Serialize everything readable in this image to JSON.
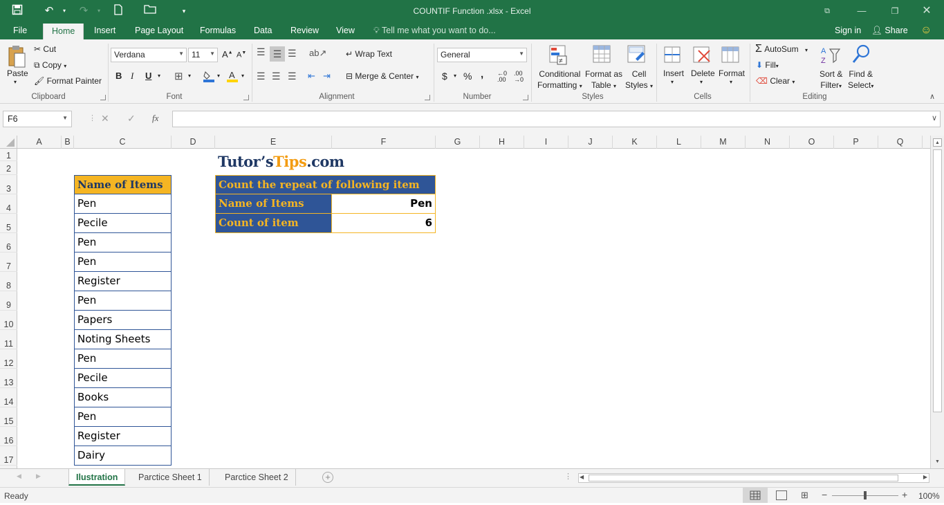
{
  "window": {
    "title": "COUNTIF Function .xlsx - Excel",
    "controls": [
      "restore-ribbon",
      "minimize",
      "maximize",
      "close"
    ]
  },
  "tabs": [
    {
      "label": "File"
    },
    {
      "label": "Home"
    },
    {
      "label": "Insert"
    },
    {
      "label": "Page Layout"
    },
    {
      "label": "Formulas"
    },
    {
      "label": "Data"
    },
    {
      "label": "Review"
    },
    {
      "label": "View"
    }
  ],
  "active_tab": "Home",
  "tell_me": "Tell me what you want to do...",
  "account": {
    "sign_in": "Sign in",
    "share": "Share"
  },
  "ribbon": {
    "clipboard": {
      "group": "Clipboard",
      "paste": "Paste",
      "cut": "Cut",
      "copy": "Copy",
      "format_painter": "Format Painter"
    },
    "font": {
      "group": "Font",
      "name": "Verdana",
      "size": "11",
      "bold": "B",
      "italic": "I",
      "underline": "U"
    },
    "alignment": {
      "group": "Alignment",
      "wrap_text": "Wrap Text",
      "merge_center": "Merge & Center"
    },
    "number": {
      "group": "Number",
      "format": "General",
      "currency": "$",
      "percent": "%",
      "comma": ","
    },
    "styles": {
      "group": "Styles",
      "conditional_1": "Conditional",
      "conditional_2": "Formatting",
      "format_table_1": "Format as",
      "format_table_2": "Table",
      "cell_styles_1": "Cell",
      "cell_styles_2": "Styles"
    },
    "cells": {
      "group": "Cells",
      "insert": "Insert",
      "delete": "Delete",
      "format": "Format"
    },
    "editing": {
      "group": "Editing",
      "autosum": "AutoSum",
      "fill": "Fill",
      "clear": "Clear",
      "sort_1": "Sort &",
      "sort_2": "Filter",
      "find_1": "Find &",
      "find_2": "Select"
    }
  },
  "formula_bar": {
    "name_box": "F6",
    "fx": "fx",
    "formula": ""
  },
  "columns": [
    "A",
    "B",
    "C",
    "D",
    "E",
    "F",
    "G",
    "H",
    "I",
    "J",
    "K",
    "L",
    "M",
    "N",
    "O",
    "P",
    "Q"
  ],
  "rows": [
    "1",
    "2",
    "3",
    "4",
    "5",
    "6",
    "7",
    "8",
    "9",
    "10",
    "11",
    "12",
    "13",
    "14",
    "15",
    "16",
    "17"
  ],
  "sheet": {
    "logo": {
      "part1": "Tutor’s",
      "part2": "Tips",
      "part3": ".com"
    },
    "list_header": "Name of Items",
    "items": [
      "Pen",
      "Pecile",
      "Pen",
      "Pen",
      "Register",
      "Pen",
      "Papers",
      "Noting Sheets",
      "Pen",
      "Pecile",
      "Books",
      "Pen",
      "Register",
      "Dairy"
    ],
    "summary": {
      "title": "Count the repeat of following item",
      "label_item": "Name of Items",
      "value_item": "Pen",
      "label_count": "Count of item",
      "value_count": "6"
    }
  },
  "sheet_tabs": [
    {
      "label": "Ilustration",
      "active": true
    },
    {
      "label": "Parctice Sheet 1",
      "active": false
    },
    {
      "label": "Parctice Sheet 2",
      "active": false
    }
  ],
  "status": {
    "mode": "Ready",
    "zoom": "100%"
  },
  "colors": {
    "accent": "#217346",
    "header_gold": "#f5b523",
    "table_blue": "#2f5597",
    "logo_navy": "#1f3864",
    "logo_orange": "#f39c12"
  }
}
